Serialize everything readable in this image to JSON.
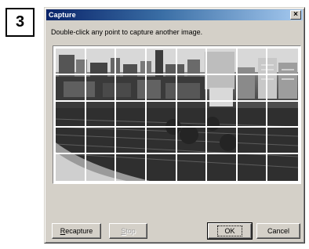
{
  "step_number": "3",
  "window": {
    "title": "Capture",
    "close_glyph": "×"
  },
  "instruction": "Double-click any point to capture another image.",
  "grid": {
    "columns": 8,
    "rows": 5
  },
  "buttons": {
    "recapture": {
      "accel": "R",
      "rest": "ecapture"
    },
    "stop": {
      "accel": "S",
      "rest": "top",
      "enabled": false
    },
    "ok": {
      "label": "OK"
    },
    "cancel": {
      "label": "Cancel"
    }
  }
}
